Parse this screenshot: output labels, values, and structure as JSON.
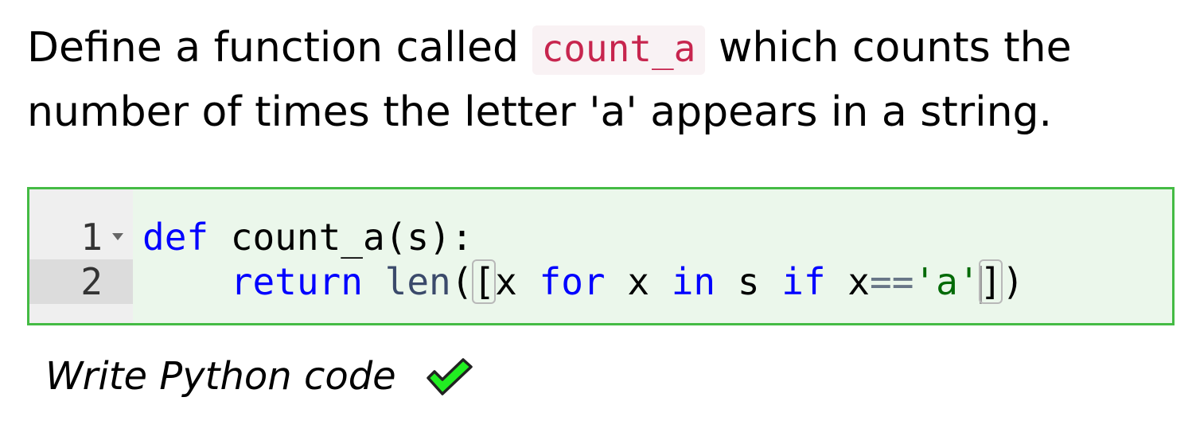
{
  "prompt": {
    "before": "Define a function called ",
    "code": "count_a",
    "after": " which counts the number of times the letter 'a' appears in a string."
  },
  "editor": {
    "language": "python",
    "line_numbers": [
      "1",
      "2"
    ],
    "active_line": 2,
    "lines": [
      [
        {
          "t": "def",
          "c": "kw"
        },
        {
          "t": " count_a(s):",
          "c": ""
        }
      ],
      [
        {
          "t": "    ",
          "c": ""
        },
        {
          "t": "return",
          "c": "kw"
        },
        {
          "t": " ",
          "c": ""
        },
        {
          "t": "len",
          "c": "builtin"
        },
        {
          "t": "(",
          "c": ""
        },
        {
          "t": "[",
          "c": "bracket-match"
        },
        {
          "t": "x ",
          "c": ""
        },
        {
          "t": "for",
          "c": "kw"
        },
        {
          "t": " x ",
          "c": ""
        },
        {
          "t": "in",
          "c": "kw"
        },
        {
          "t": " s ",
          "c": ""
        },
        {
          "t": "if",
          "c": "kw"
        },
        {
          "t": " x",
          "c": ""
        },
        {
          "t": "==",
          "c": "op"
        },
        {
          "t": "'a'",
          "c": "str"
        },
        {
          "t": "]",
          "c": "bracket-match cursor-before"
        },
        {
          "t": ")",
          "c": ""
        }
      ]
    ],
    "colors": {
      "border": "#44bb44",
      "background": "#ebf7eb",
      "keyword": "#0000ff",
      "string": "#036a07"
    }
  },
  "footer": {
    "label": "Write Python code",
    "status_icon": "checkmark-icon",
    "status": "correct"
  }
}
